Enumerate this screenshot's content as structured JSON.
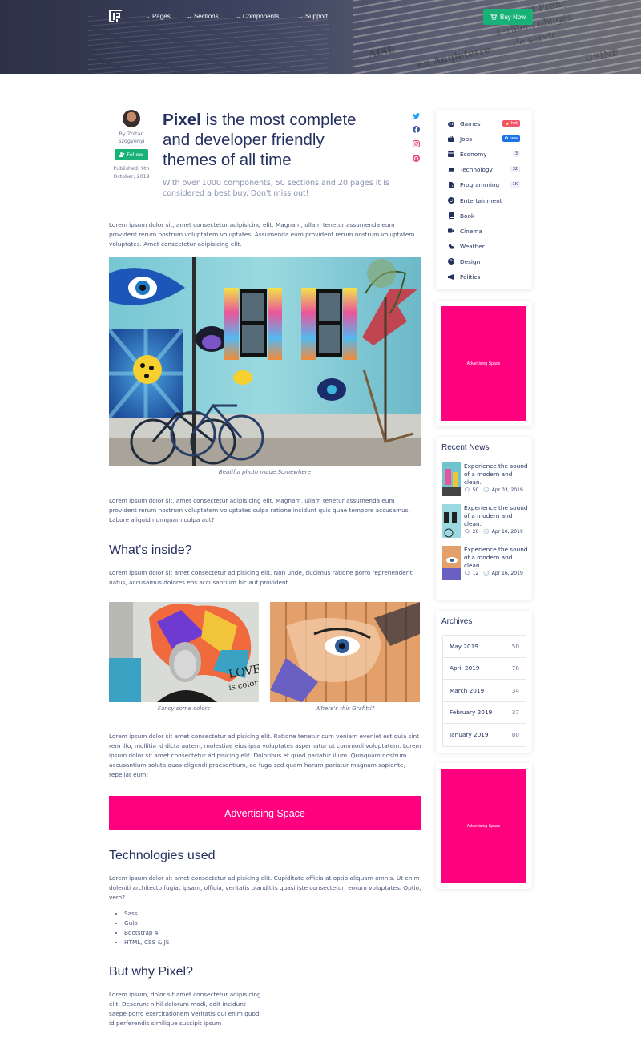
{
  "nav": {
    "items": [
      "Pages",
      "Sections",
      "Components",
      "Support"
    ],
    "buy_label": "Buy Now"
  },
  "hero_words": [
    "Belges et Franç",
    "seraient obligés",
    "de servir",
    "en Angleterre",
    "AISE",
    "USINE"
  ],
  "author": {
    "by": "By Zoltan Szogyenyi",
    "follow": "Follow",
    "published": "Published: 9th October, 2019"
  },
  "article": {
    "title_brand": "Pixel",
    "title_rest": " is the most complete and developer friendly themes of all time",
    "subtitle": "With over 1000 components, 50 sections and 20 pages it is considered a best buy. Don't miss out!",
    "p1": "Lorem ipsum dolor sit, amet consectetur adipisicing elit. Magnam, ullam tenetur assumenda eum provident rerum nostrum voluptatem voluptates. Assumenda eum provident rerum nostrum voluptatem voluptates. Amet consectetur adipisicing elit.",
    "photo_caption": "Beatiful photo made Somewhere",
    "p2": "Lorem ipsum dolor sit, amet consectetur adipisicing elit. Magnam, ullam tenetur assumenda eum provident rerum nostrum voluptatem voluptates culpa ratione incidunt quis quae tempore accusamus. Labore aliquid numquam culpa aut?",
    "h_inside": "What's inside?",
    "p3": "Lorem ipsum dolor sit amet consectetur adipisicing elit. Non unde, ducimus ratione porro reprehenderit natus, accusamus dolores eos accusantium hic aut provident.",
    "cap_left": "Fancy some colors",
    "cap_right": "Where's this Grafitti?",
    "p4": "Lorem ipsum dolor sit amet consectetur adipisicing elit. Ratione tenetur cum veniam eveniet est quia sint rem illo, mollitia id dicta autem, molestiae eius ipsa voluptates aspernatur ut commodi voluptatem. Lorem ipsum dolor sit amet consectetur adipisicing elit. Doloribus et quod pariatur illum. Quisquam nostrum accusantium soluta quas eligendi praesentium, ad fuga sed quam harum pariatur magnam sapiente, repellat eum!",
    "ad_wide": "Advertising Space",
    "h_tech": "Technologies used",
    "p5": "Lorem ipsum dolor sit amet consectetur adipisicing elit. Cupiditate officia at optio aliquam omnis. Ut enim doleniti architecto fugiat ipsam, officia, veritatis blanditiis quasi iste consectetur, eorum voluptates. Optio, vero?",
    "tech": [
      "Sass",
      "Gulp",
      "Bootstrap 4",
      "HTML, CSS & JS"
    ],
    "h_why": "But why Pixel?",
    "p6": "Lorem ipsum, dolor sit amet consectetur adipisicing elit. Deserunt nihil dolorum modi, odit incidunt saepe porro exercitationem veritatis qui enim quod, id perferendis similique suscipit ipsum"
  },
  "categories": [
    {
      "label": "Games",
      "badge": "hot",
      "badge_color": "#f0566b"
    },
    {
      "label": "Jobs",
      "badge": "new",
      "badge_color": "#1a73e8"
    },
    {
      "label": "Economy",
      "badge": "3",
      "badge_color": "#eef1f8"
    },
    {
      "label": "Technology",
      "badge": "32",
      "badge_color": "#eef1f8"
    },
    {
      "label": "Programming",
      "badge": "1K",
      "badge_color": "#eef1f8"
    },
    {
      "label": "Entertainment",
      "badge": "",
      "badge_color": ""
    },
    {
      "label": "Book",
      "badge": "",
      "badge_color": ""
    },
    {
      "label": "Cinema",
      "badge": "",
      "badge_color": ""
    },
    {
      "label": "Weather",
      "badge": "",
      "badge_color": ""
    },
    {
      "label": "Design",
      "badge": "",
      "badge_color": ""
    },
    {
      "label": "Politics",
      "badge": "",
      "badge_color": ""
    }
  ],
  "ad_side": "Advertising Space",
  "recent": {
    "heading": "Recent News",
    "items": [
      {
        "title": "Experience the sound of a modern and clean.",
        "comments": "50",
        "date": "Apr 03, 2019"
      },
      {
        "title": "Experience the sound of a modern and clean.",
        "comments": "26",
        "date": "Apr 10, 2019"
      },
      {
        "title": "Experience the sound of a modern and clean.",
        "comments": "12",
        "date": "Apr 16, 2019"
      }
    ]
  },
  "archives": {
    "heading": "Archives",
    "items": [
      {
        "month": "May 2019",
        "count": "50"
      },
      {
        "month": "April 2019",
        "count": "78"
      },
      {
        "month": "March 2019",
        "count": "34"
      },
      {
        "month": "February 2019",
        "count": "37"
      },
      {
        "month": "January 2019",
        "count": "80"
      }
    ]
  },
  "colors": {
    "accent_green": "#18b178",
    "ad_pink": "#ff007f",
    "navy": "#24305e"
  }
}
